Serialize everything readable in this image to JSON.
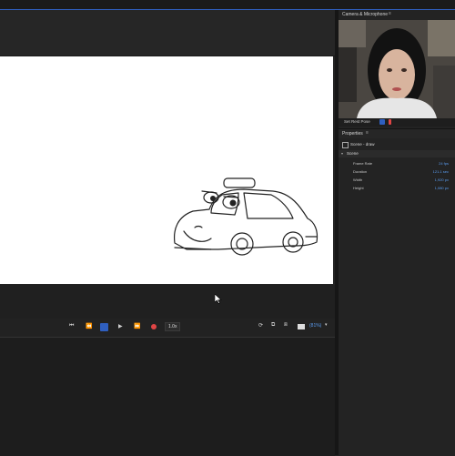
{
  "camera_panel": {
    "title": "Camera & Microphone",
    "set_rest_pose": "Set Rest Pose"
  },
  "properties_panel": {
    "title": "Properties",
    "scene_title": "Scene - draw",
    "section": "Scene",
    "rows": [
      {
        "label": "Frame Rate",
        "value": "24 fps"
      },
      {
        "label": "Duration",
        "value": "121.1 sec"
      },
      {
        "label": "Width",
        "value": "1,920 px"
      },
      {
        "label": "Height",
        "value": "1,080 px"
      }
    ]
  },
  "transport": {
    "speed": "1.0x",
    "zoom": "(81%)"
  },
  "colors": {
    "accent": "#5a9cf0",
    "record": "#e04545",
    "canvas": "#ffffff"
  }
}
